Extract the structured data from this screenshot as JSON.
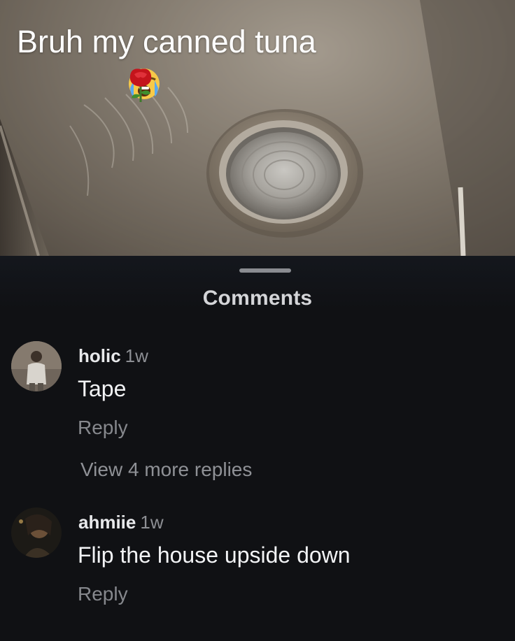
{
  "post": {
    "caption": "Bruh my canned tuna",
    "emojis": [
      "loudly-crying-face",
      "rose"
    ]
  },
  "comments_sheet": {
    "title": "Comments",
    "comments": [
      {
        "username": "holic",
        "time": "1w",
        "text": "Tape",
        "reply_label": "Reply",
        "more_replies_label": "View 4 more replies"
      },
      {
        "username": "ahmiie",
        "time": "1w",
        "text": "Flip the house upside down",
        "reply_label": "Reply"
      }
    ]
  },
  "colors": {
    "sheet_background": "#101114",
    "secondary_text": "#86888d",
    "primary_text": "#f2f3f5"
  }
}
